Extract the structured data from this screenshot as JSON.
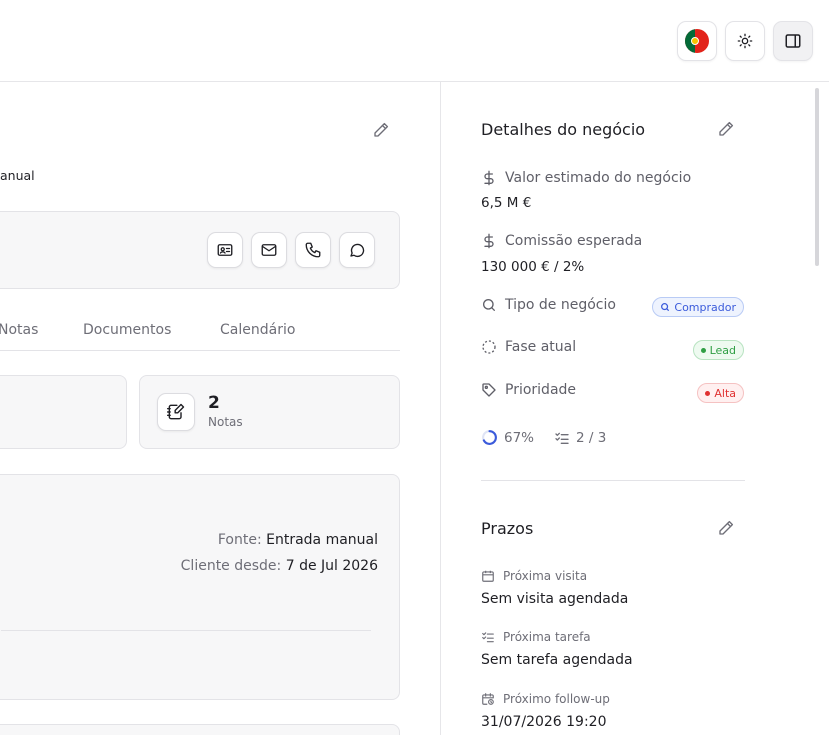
{
  "left": {
    "source_partial": "anual",
    "tabs": [
      "Notas",
      "Documentos",
      "Calendário"
    ],
    "notes_stat": {
      "count": "2",
      "label": "Notas"
    },
    "info": {
      "source_label": "Fonte:",
      "source_value": "Entrada manual",
      "client_since_label": "Cliente desde:",
      "client_since_value": "7 de Jul 2026"
    }
  },
  "deal": {
    "title": "Detalhes do negócio",
    "estimated_value_label": "Valor estimado do negócio",
    "estimated_value": "6,5 M €",
    "commission_label": "Comissão esperada",
    "commission_value": "130 000 € / 2%",
    "type_label": "Tipo de negócio",
    "type_badge": "Comprador",
    "phase_label": "Fase atual",
    "phase_badge": "Lead",
    "priority_label": "Prioridade",
    "priority_badge": "Alta",
    "progress_percent_text": "67%",
    "progress_fraction": 0.67,
    "tasks_text": "2 / 3"
  },
  "deadlines": {
    "title": "Prazos",
    "next_visit_label": "Próxima visita",
    "next_visit_value": "Sem visita agendada",
    "next_task_label": "Próxima tarefa",
    "next_task_value": "Sem tarefa agendada",
    "next_followup_label": "Próximo follow-up",
    "next_followup_value": "31/07/2026 19:20"
  },
  "colors": {
    "border": "#e3e3e7",
    "muted": "#6e6e77",
    "blue": "#3b5bdb",
    "green": "#2f9e44",
    "red": "#e03131"
  },
  "icons": {
    "topbar": [
      "portugal-flag-icon",
      "sun-icon",
      "sidebar-panel-icon"
    ],
    "contact_actions": [
      "id-card-icon",
      "mail-icon",
      "phone-icon",
      "chat-icon"
    ]
  }
}
